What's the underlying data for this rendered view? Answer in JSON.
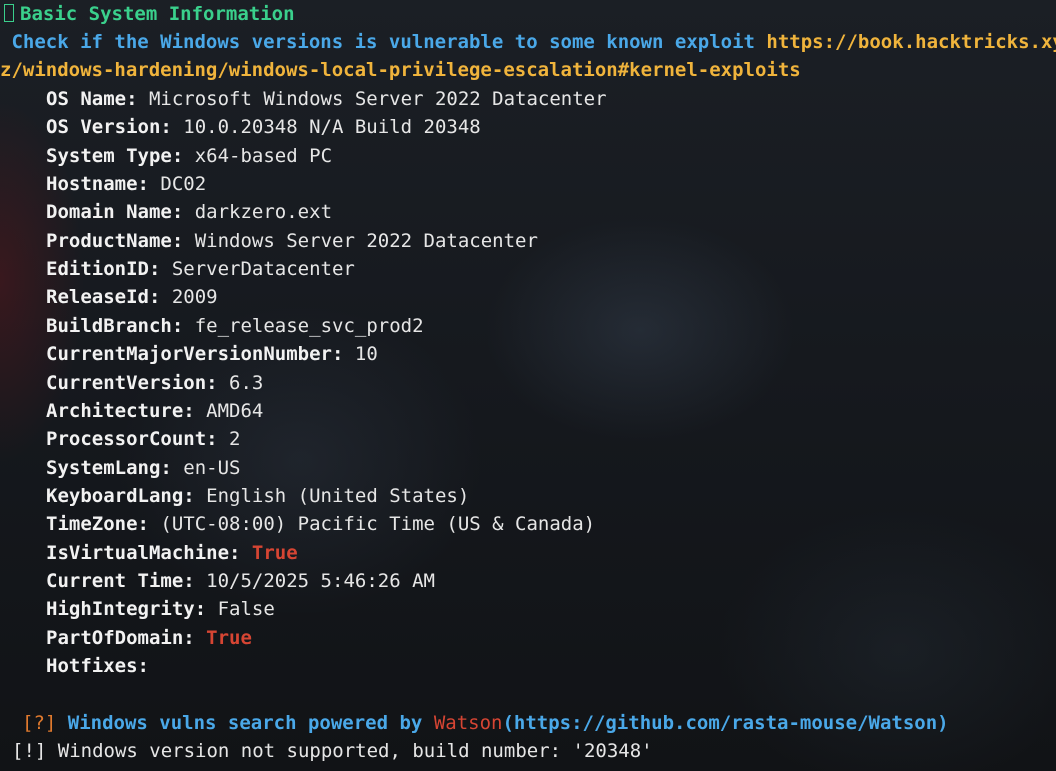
{
  "header": {
    "title": "Basic System Information",
    "check_text": " Check if the Windows versions is vulnerable to some known exploit ",
    "url_line1": "https://book.hacktricks.xy",
    "url_line2": "z/windows-hardening/windows-local-privilege-escalation#kernel-exploits"
  },
  "info": [
    {
      "key": "OS Name",
      "value": "Microsoft Windows Server 2022 Datacenter",
      "highlight": false
    },
    {
      "key": "OS Version",
      "value": "10.0.20348 N/A Build 20348",
      "highlight": false
    },
    {
      "key": "System Type",
      "value": "x64-based PC",
      "highlight": false
    },
    {
      "key": "Hostname",
      "value": "DC02",
      "highlight": false
    },
    {
      "key": "Domain Name",
      "value": "darkzero.ext",
      "highlight": false
    },
    {
      "key": "ProductName",
      "value": "Windows Server 2022 Datacenter",
      "highlight": false
    },
    {
      "key": "EditionID",
      "value": "ServerDatacenter",
      "highlight": false
    },
    {
      "key": "ReleaseId",
      "value": "2009",
      "highlight": false
    },
    {
      "key": "BuildBranch",
      "value": "fe_release_svc_prod2",
      "highlight": false
    },
    {
      "key": "CurrentMajorVersionNumber",
      "value": "10",
      "highlight": false
    },
    {
      "key": "CurrentVersion",
      "value": "6.3",
      "highlight": false
    },
    {
      "key": "Architecture",
      "value": "AMD64",
      "highlight": false
    },
    {
      "key": "ProcessorCount",
      "value": "2",
      "highlight": false
    },
    {
      "key": "SystemLang",
      "value": "en-US",
      "highlight": false
    },
    {
      "key": "KeyboardLang",
      "value": "English (United States)",
      "highlight": false
    },
    {
      "key": "TimeZone",
      "value": "(UTC-08:00) Pacific Time (US & Canada)",
      "highlight": false
    },
    {
      "key": "IsVirtualMachine",
      "value": "True",
      "highlight": true
    },
    {
      "key": "Current Time",
      "value": "10/5/2025 5:46:26 AM",
      "highlight": false
    },
    {
      "key": "HighIntegrity",
      "value": "False",
      "highlight": false
    },
    {
      "key": "PartOfDomain",
      "value": "True",
      "highlight": true
    },
    {
      "key": "Hotfixes",
      "value": "",
      "highlight": false
    }
  ],
  "watson": {
    "bracket": "[?]",
    "text": " Windows vulns search powered by ",
    "name": "Watson",
    "url": "(https://github.com/rasta-mouse/Watson)"
  },
  "warning": "[!] Windows version not supported, build number: '20348'",
  "colors": {
    "title_green": "#3ad08c",
    "info_blue": "#4aa8e8",
    "url_yellow": "#f0b43c",
    "true_red": "#d64533",
    "bracket_orange": "#e07a2e"
  }
}
